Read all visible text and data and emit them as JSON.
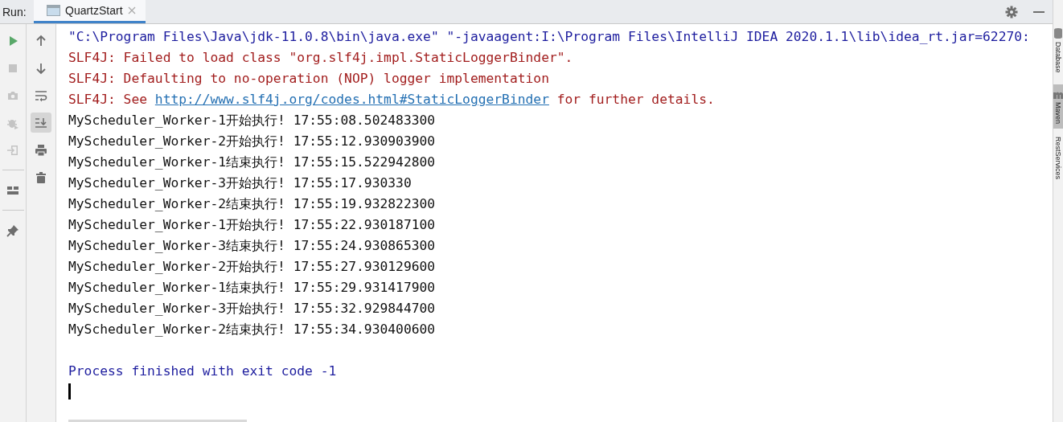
{
  "run_label": "Run:",
  "tabs": [
    {
      "label": "QuartzStart",
      "selected": true
    }
  ],
  "header_tools": [
    {
      "kind": "settings"
    },
    {
      "kind": "minimize"
    }
  ],
  "left_toolbar": [
    {
      "kind": "run",
      "disabled": false
    },
    {
      "kind": "stop",
      "disabled": true
    },
    {
      "kind": "camera",
      "disabled": true
    },
    {
      "kind": "bug",
      "disabled": true
    },
    {
      "kind": "exit",
      "disabled": true
    },
    {
      "kind": "separator"
    },
    {
      "kind": "layout",
      "disabled": false
    },
    {
      "kind": "separator"
    },
    {
      "kind": "pin",
      "disabled": false
    }
  ],
  "console_toolbar": [
    {
      "kind": "up",
      "selected": false
    },
    {
      "kind": "down",
      "selected": false
    },
    {
      "kind": "wrap",
      "selected": false
    },
    {
      "kind": "scroll-end",
      "selected": true
    },
    {
      "kind": "print",
      "selected": false
    },
    {
      "kind": "trash",
      "selected": false
    }
  ],
  "console": {
    "caret": true,
    "lines": [
      {
        "kind": "command",
        "text": "\"C:\\Program Files\\Java\\jdk-11.0.8\\bin\\java.exe\" \"-javaagent:I:\\Program Files\\IntelliJ IDEA 2020.1.1\\lib\\idea_rt.jar=62270:"
      },
      {
        "kind": "error",
        "text": "SLF4J: Failed to load class \"org.slf4j.impl.StaticLoggerBinder\"."
      },
      {
        "kind": "error",
        "text": "SLF4J: Defaulting to no-operation (NOP) logger implementation"
      },
      {
        "kind": "error-link",
        "text": "SLF4J: See",
        "link": "http://www.slf4j.org/codes.html#StaticLoggerBinder",
        "after": "for further details."
      },
      {
        "kind": "output",
        "text": "MyScheduler_Worker-1开始执行! 17:55:08.502483300"
      },
      {
        "kind": "output",
        "text": "MyScheduler_Worker-2开始执行! 17:55:12.930903900"
      },
      {
        "kind": "output",
        "text": "MyScheduler_Worker-1结束执行! 17:55:15.522942800"
      },
      {
        "kind": "output",
        "text": "MyScheduler_Worker-3开始执行! 17:55:17.930330"
      },
      {
        "kind": "output",
        "text": "MyScheduler_Worker-2结束执行! 17:55:19.932822300"
      },
      {
        "kind": "output",
        "text": "MyScheduler_Worker-1开始执行! 17:55:22.930187100"
      },
      {
        "kind": "output",
        "text": "MyScheduler_Worker-3结束执行! 17:55:24.930865300"
      },
      {
        "kind": "output",
        "text": "MyScheduler_Worker-2开始执行! 17:55:27.930129600"
      },
      {
        "kind": "output",
        "text": "MyScheduler_Worker-1结束执行! 17:55:29.931417900"
      },
      {
        "kind": "output",
        "text": "MyScheduler_Worker-3开始执行! 17:55:32.929844700"
      },
      {
        "kind": "output",
        "text": "MyScheduler_Worker-2结束执行! 17:55:34.930400600"
      },
      {
        "kind": "blank"
      },
      {
        "kind": "system",
        "text": "Process finished with exit code -1"
      }
    ]
  },
  "side_tools": [
    {
      "kind": "database",
      "label": "Database",
      "selected": false
    },
    {
      "kind": "maven",
      "label": "Maven",
      "selected": true
    },
    {
      "kind": "plain",
      "label": "RestServices",
      "selected": false
    }
  ]
}
